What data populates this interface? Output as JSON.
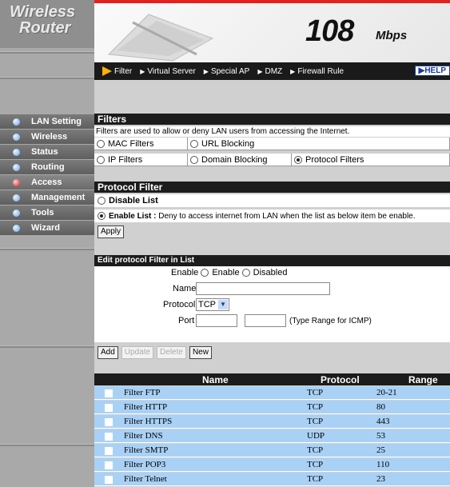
{
  "brand": {
    "line1": "Wireless",
    "line2": "Router"
  },
  "header": {
    "speed": "108",
    "unit": "Mbps",
    "help": "HELP"
  },
  "nav": {
    "items": [
      "Filter",
      "Virtual Server",
      "Special AP",
      "DMZ",
      "Firewall Rule"
    ]
  },
  "sidebar": {
    "items": [
      {
        "label": "LAN Setting",
        "active": false
      },
      {
        "label": "Wireless",
        "active": false
      },
      {
        "label": "Status",
        "active": false
      },
      {
        "label": "Routing",
        "active": false
      },
      {
        "label": "Access",
        "active": true
      },
      {
        "label": "Management",
        "active": false
      },
      {
        "label": "Tools",
        "active": false
      },
      {
        "label": "Wizard",
        "active": false
      }
    ]
  },
  "filters": {
    "title": "Filters",
    "description": "Filters are used to allow or deny LAN users from accessing the Internet.",
    "options": [
      "MAC Filters",
      "URL Blocking",
      "IP Filters",
      "Domain Blocking",
      "Protocol Filters"
    ],
    "selected": "Protocol Filters"
  },
  "protocol_filter": {
    "title": "Protocol Filter",
    "disable_label": "Disable List",
    "enable_label": "Enable List :",
    "enable_desc": "Deny to access internet from LAN when the list as below item be enable.",
    "apply": "Apply"
  },
  "edit": {
    "title": "Edit protocol Filter in List",
    "enable_label": "Enable",
    "enable_opt": "Enable",
    "disabled_opt": "Disabled",
    "name_label": "Name",
    "protocol_label": "Protocol",
    "protocol_value": "TCP",
    "port_label": "Port",
    "port_hint": "(Type Range for ICMP)",
    "buttons": {
      "add": "Add",
      "update": "Update",
      "delete": "Delete",
      "new": "New"
    }
  },
  "table": {
    "headers": {
      "name": "Name",
      "protocol": "Protocol",
      "range": "Range"
    },
    "rows": [
      {
        "name": "Filter FTP",
        "protocol": "TCP",
        "range": "20-21"
      },
      {
        "name": "Filter HTTP",
        "protocol": "TCP",
        "range": "80"
      },
      {
        "name": "Filter HTTPS",
        "protocol": "TCP",
        "range": "443"
      },
      {
        "name": "Filter DNS",
        "protocol": "UDP",
        "range": "53"
      },
      {
        "name": "Filter SMTP",
        "protocol": "TCP",
        "range": "25"
      },
      {
        "name": "Filter POP3",
        "protocol": "TCP",
        "range": "110"
      },
      {
        "name": "Filter Telnet",
        "protocol": "TCP",
        "range": "23"
      }
    ]
  }
}
